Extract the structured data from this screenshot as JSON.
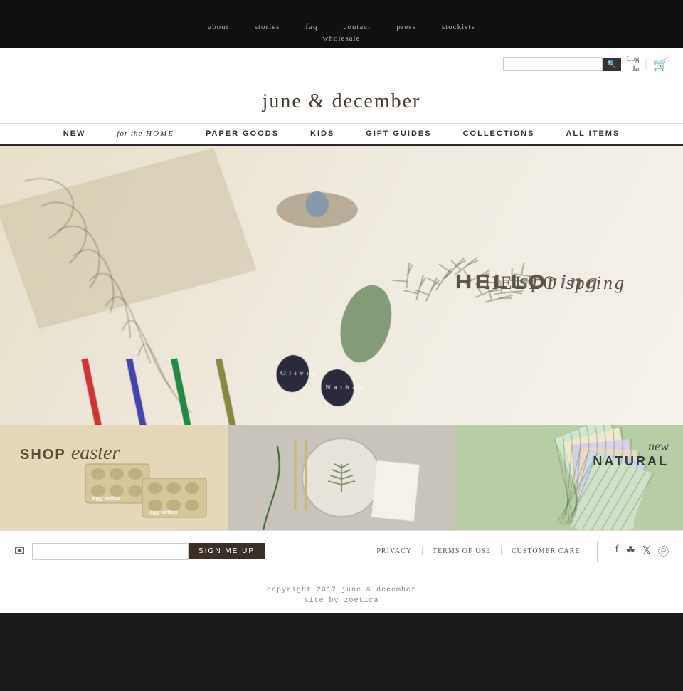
{
  "topbar": {
    "visible": true
  },
  "topnav": {
    "items": [
      {
        "label": "about",
        "href": "#"
      },
      {
        "label": "stories",
        "href": "#"
      },
      {
        "label": "FAQ",
        "href": "#"
      },
      {
        "label": "contact",
        "href": "#"
      },
      {
        "label": "press",
        "href": "#"
      },
      {
        "label": "stockists",
        "href": "#"
      }
    ],
    "wholesale": "wholesale"
  },
  "search": {
    "placeholder": "",
    "button_label": "🔍"
  },
  "account": {
    "login_label": "Log\nIn",
    "cart_icon": "🛒"
  },
  "logo": {
    "text": "june & december"
  },
  "mainnav": {
    "items": [
      {
        "label": "NEW",
        "special": false
      },
      {
        "label": "for the HOME",
        "special": true
      },
      {
        "label": "PAPER GOODS",
        "special": false
      },
      {
        "label": "KIDS",
        "special": false
      },
      {
        "label": "GIFT GUIDES",
        "special": false
      },
      {
        "label": "COLLECTIONS",
        "special": false
      },
      {
        "label": "ALL ITEMS",
        "special": false
      }
    ]
  },
  "hero": {
    "text_hello": "HELLO",
    "text_spring": "spring"
  },
  "promo": {
    "tiles": [
      {
        "id": "easter",
        "shop": "SHOP",
        "name": "easter",
        "bg": "#e8dfc8"
      },
      {
        "id": "table",
        "bg": "#d8d4cc"
      },
      {
        "id": "natural",
        "new": "new",
        "natural": "NATURAL",
        "bg": "#c8d8c0"
      }
    ]
  },
  "footer": {
    "email_placeholder": "",
    "signup_label": "SIGN ME UP",
    "links": [
      {
        "label": "PRIVACY"
      },
      {
        "label": "TERMS OF USE"
      },
      {
        "label": "CUSTOMER CARE"
      }
    ],
    "social": [
      "f",
      "📷",
      "🐦",
      "📌"
    ],
    "copyright": "copyright 2017 june & december",
    "site_by": "site by zoetica"
  }
}
